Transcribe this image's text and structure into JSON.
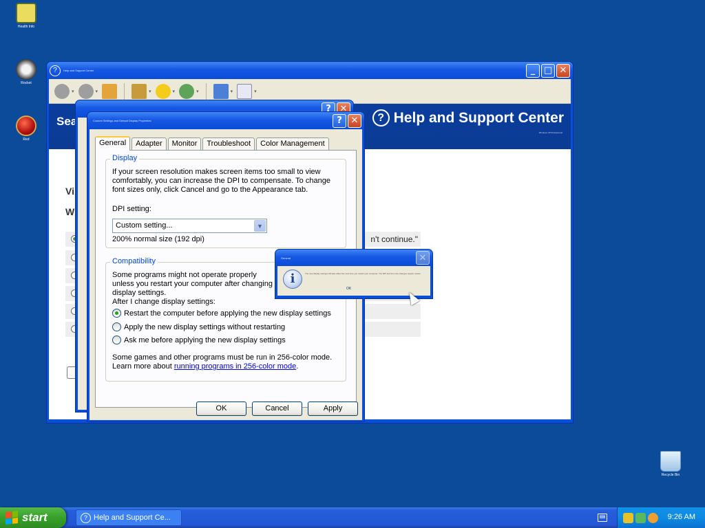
{
  "desktop": {
    "icons": [
      {
        "name": "desktop-icon-health",
        "label": "Health Info"
      },
      {
        "name": "desktop-icon-raccoon",
        "label": "Rocket"
      },
      {
        "name": "desktop-icon-red",
        "label": "Red"
      },
      {
        "name": "recycle-bin",
        "label": "Recycle Bin"
      }
    ]
  },
  "help_window": {
    "title": "Help and Support Center",
    "banner_search": "Sea",
    "banner_title": "Help and Support Center",
    "banner_sub": "Windows XP Professional",
    "body_line1": "Vi",
    "body_line2": "Wh",
    "row_text": "n't continue.\""
  },
  "display_dialog": {
    "title": "Custom Settings and Default Display Properties",
    "tabs": [
      "General",
      "Adapter",
      "Monitor",
      "Troubleshoot",
      "Color Management"
    ],
    "display_group": {
      "legend": "Display",
      "text": "If your screen resolution makes screen items too small to view comfortably, you can increase the DPI to compensate.  To change font sizes only, click Cancel and go to the Appearance tab.",
      "dpi_label": "DPI setting:",
      "dpi_value": "Custom setting...",
      "dpi_note": "200% normal size (192 dpi)"
    },
    "compat_group": {
      "legend": "Compatibility",
      "text": "Some programs might not operate properly unless you restart your computer after changing display settings.",
      "after_label": "After I change display settings:",
      "options": [
        "Restart the computer before applying the new display settings",
        "Apply the new display settings without restarting",
        "Ask me before applying the new display settings"
      ],
      "selected_index": 0,
      "games_text": "Some games and other programs must be run in 256-color mode.",
      "learn_prefix": "Learn more about ",
      "learn_link": "running programs in 256-color mode",
      "learn_suffix": "."
    },
    "buttons": {
      "ok": "OK",
      "cancel": "Cancel",
      "apply": "Apply"
    }
  },
  "info_dialog": {
    "title": "General",
    "icon": "information-icon",
    "message": "The new display settings will take effect the next time you restart your computer. The DPI and font size changes require restart.",
    "ok": "OK"
  },
  "taskbar": {
    "start_label": "start",
    "task_label": "Help and Support Ce...",
    "clock": "9:26 AM"
  },
  "colors": {
    "desktop": "#0c4a9a",
    "titlebar": "#0a4fd8",
    "start": "#37a02a",
    "banner": "#0a3d9e"
  }
}
